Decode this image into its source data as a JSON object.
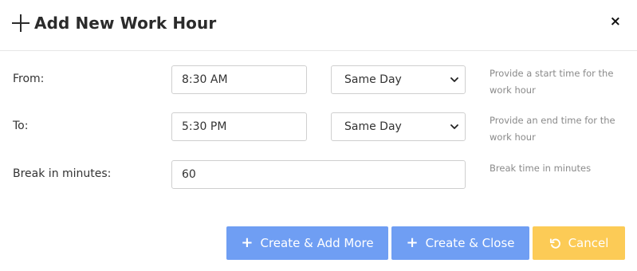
{
  "modal": {
    "title": "Add New Work Hour",
    "close_label": "×"
  },
  "form": {
    "from": {
      "label": "From:",
      "time_value": "8:30 AM",
      "day_value": "Same Day",
      "help": "Provide a start time for the work hour"
    },
    "to": {
      "label": "To:",
      "time_value": "5:30 PM",
      "day_value": "Same Day",
      "help": "Provide an end time for the work hour"
    },
    "break": {
      "label": "Break in minutes:",
      "value": "60",
      "help": "Break time in minutes"
    }
  },
  "actions": {
    "create_add_more": "Create & Add More",
    "create_close": "Create & Close",
    "cancel": "Cancel"
  },
  "colors": {
    "primary": "#6f9ef3",
    "warning": "#fccb56",
    "help_text": "#8a8a8a"
  }
}
